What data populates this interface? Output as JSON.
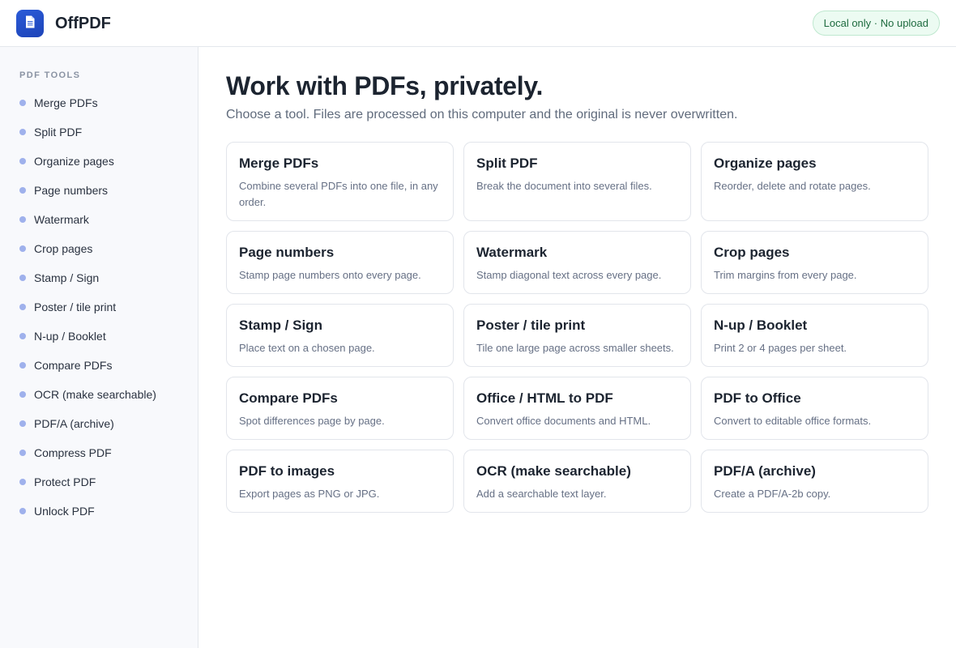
{
  "header": {
    "app_title": "OffPDF",
    "logo_icon": "document-icon",
    "privacy_badge": "Local only · No upload"
  },
  "colors": {
    "accent": "#2b5bd8",
    "badge_bg": "#ecfbf2",
    "badge_text": "#1e6a3f",
    "nav_dot": "#9fb1ec"
  },
  "sidebar": {
    "heading": "PDF TOOLS",
    "items": [
      {
        "label": "Merge PDFs"
      },
      {
        "label": "Split PDF"
      },
      {
        "label": "Organize pages"
      },
      {
        "label": "Page numbers"
      },
      {
        "label": "Watermark"
      },
      {
        "label": "Crop pages"
      },
      {
        "label": "Stamp / Sign"
      },
      {
        "label": "Poster / tile print"
      },
      {
        "label": "N-up / Booklet"
      },
      {
        "label": "Compare PDFs"
      },
      {
        "label": "OCR (make searchable)"
      },
      {
        "label": "PDF/A (archive)"
      },
      {
        "label": "Compress PDF"
      },
      {
        "label": "Protect PDF"
      },
      {
        "label": "Unlock PDF"
      }
    ]
  },
  "main": {
    "title": "Work with PDFs, privately.",
    "subtitle": "Choose a tool. Files are processed on this computer and the original is never overwritten.",
    "tools": [
      {
        "title": "Merge PDFs",
        "desc": "Combine several PDFs into one file, in any order."
      },
      {
        "title": "Split PDF",
        "desc": "Break the document into several files."
      },
      {
        "title": "Organize pages",
        "desc": "Reorder, delete and rotate pages."
      },
      {
        "title": "Page numbers",
        "desc": "Stamp page numbers onto every page."
      },
      {
        "title": "Watermark",
        "desc": "Stamp diagonal text across every page."
      },
      {
        "title": "Crop pages",
        "desc": "Trim margins from every page."
      },
      {
        "title": "Stamp / Sign",
        "desc": "Place text on a chosen page."
      },
      {
        "title": "Poster / tile print",
        "desc": "Tile one large page across smaller sheets."
      },
      {
        "title": "N-up / Booklet",
        "desc": "Print 2 or 4 pages per sheet."
      },
      {
        "title": "Compare PDFs",
        "desc": "Spot differences page by page."
      },
      {
        "title": "Office / HTML to PDF",
        "desc": "Convert office documents and HTML."
      },
      {
        "title": "PDF to Office",
        "desc": "Convert to editable office formats."
      },
      {
        "title": "PDF to images",
        "desc": "Export pages as PNG or JPG."
      },
      {
        "title": "OCR (make searchable)",
        "desc": "Add a searchable text layer."
      },
      {
        "title": "PDF/A (archive)",
        "desc": "Create a PDF/A-2b copy."
      }
    ]
  }
}
